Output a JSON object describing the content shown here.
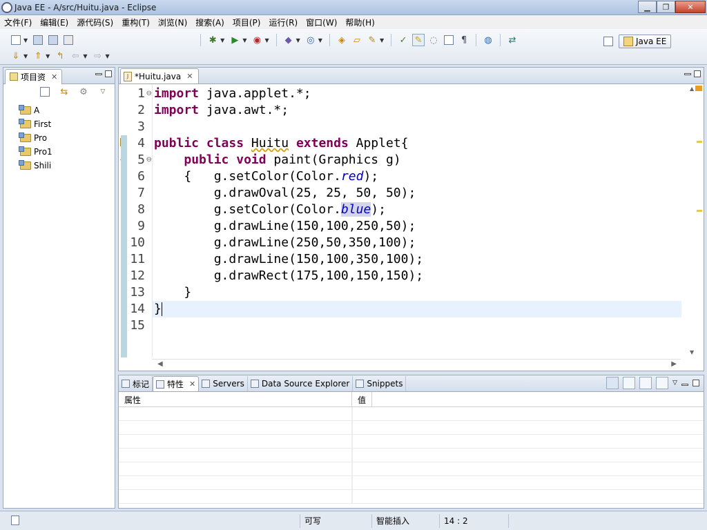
{
  "window": {
    "title": "Java EE  -  A/src/Huitu.java  -  Eclipse"
  },
  "menu": [
    "文件(F)",
    "编辑(E)",
    "源代码(S)",
    "重构(T)",
    "浏览(N)",
    "搜索(A)",
    "项目(P)",
    "运行(R)",
    "窗口(W)",
    "帮助(H)"
  ],
  "perspective": {
    "label": "Java EE"
  },
  "explorer": {
    "tab_label": "项目资",
    "projects": [
      "A",
      "First",
      "Pro",
      "Pro1",
      "Shili"
    ]
  },
  "editor": {
    "tab_label": "*Huitu.java",
    "current_line": 14,
    "lines": [
      {
        "n": "1",
        "fold": "⊖"
      },
      {
        "n": "2",
        "fold": ""
      },
      {
        "n": "3",
        "fold": ""
      },
      {
        "n": "4",
        "fold": ""
      },
      {
        "n": "5",
        "fold": "⊖"
      },
      {
        "n": "6",
        "fold": ""
      },
      {
        "n": "7",
        "fold": ""
      },
      {
        "n": "8",
        "fold": ""
      },
      {
        "n": "9",
        "fold": ""
      },
      {
        "n": "10",
        "fold": ""
      },
      {
        "n": "11",
        "fold": ""
      },
      {
        "n": "12",
        "fold": ""
      },
      {
        "n": "13",
        "fold": ""
      },
      {
        "n": "14",
        "fold": ""
      },
      {
        "n": "15",
        "fold": ""
      }
    ],
    "code": [
      [
        {
          "t": "import",
          "c": "kw"
        },
        {
          "t": " java.applet.*;"
        }
      ],
      [
        {
          "t": "import",
          "c": "kw"
        },
        {
          "t": " java.awt.*;"
        }
      ],
      [],
      [
        {
          "t": "public",
          "c": "kw"
        },
        {
          "t": " "
        },
        {
          "t": "class",
          "c": "kw"
        },
        {
          "t": " "
        },
        {
          "t": "Huitu",
          "c": "squig"
        },
        {
          "t": " "
        },
        {
          "t": "extends",
          "c": "kw"
        },
        {
          "t": " Applet{"
        }
      ],
      [
        {
          "t": "    "
        },
        {
          "t": "public",
          "c": "kw"
        },
        {
          "t": " "
        },
        {
          "t": "void",
          "c": "kw"
        },
        {
          "t": " paint(Graphics g)"
        }
      ],
      [
        {
          "t": "    {   g.setColor(Color."
        },
        {
          "t": "red",
          "c": "fld"
        },
        {
          "t": ");"
        }
      ],
      [
        {
          "t": "        g.drawOval(25, 25, 50, 50);"
        }
      ],
      [
        {
          "t": "        g.setColor(Color."
        },
        {
          "t": "blue",
          "c": "fld hl-word"
        },
        {
          "t": ");"
        }
      ],
      [
        {
          "t": "        g.drawLine(150,100,250,50);"
        }
      ],
      [
        {
          "t": "        g.drawLine(250,50,350,100);"
        }
      ],
      [
        {
          "t": "        g.drawLine(150,100,350,100);"
        }
      ],
      [
        {
          "t": "        g.drawRect(175,100,150,150);"
        }
      ],
      [
        {
          "t": "    }"
        }
      ],
      [
        {
          "t": "}"
        },
        {
          "t": "",
          "c": "cursor"
        }
      ],
      []
    ]
  },
  "bottom_panel": {
    "tabs": [
      {
        "label": "标记",
        "active": false,
        "closable": false
      },
      {
        "label": "特性",
        "active": true,
        "closable": true
      },
      {
        "label": "Servers",
        "active": false,
        "closable": false
      },
      {
        "label": "Data Source Explorer",
        "active": false,
        "closable": false
      },
      {
        "label": "Snippets",
        "active": false,
        "closable": false
      }
    ],
    "columns": [
      "属性",
      "值"
    ]
  },
  "status": {
    "writable": "可写",
    "insert_mode": "智能插入",
    "position": "14 : 2"
  }
}
